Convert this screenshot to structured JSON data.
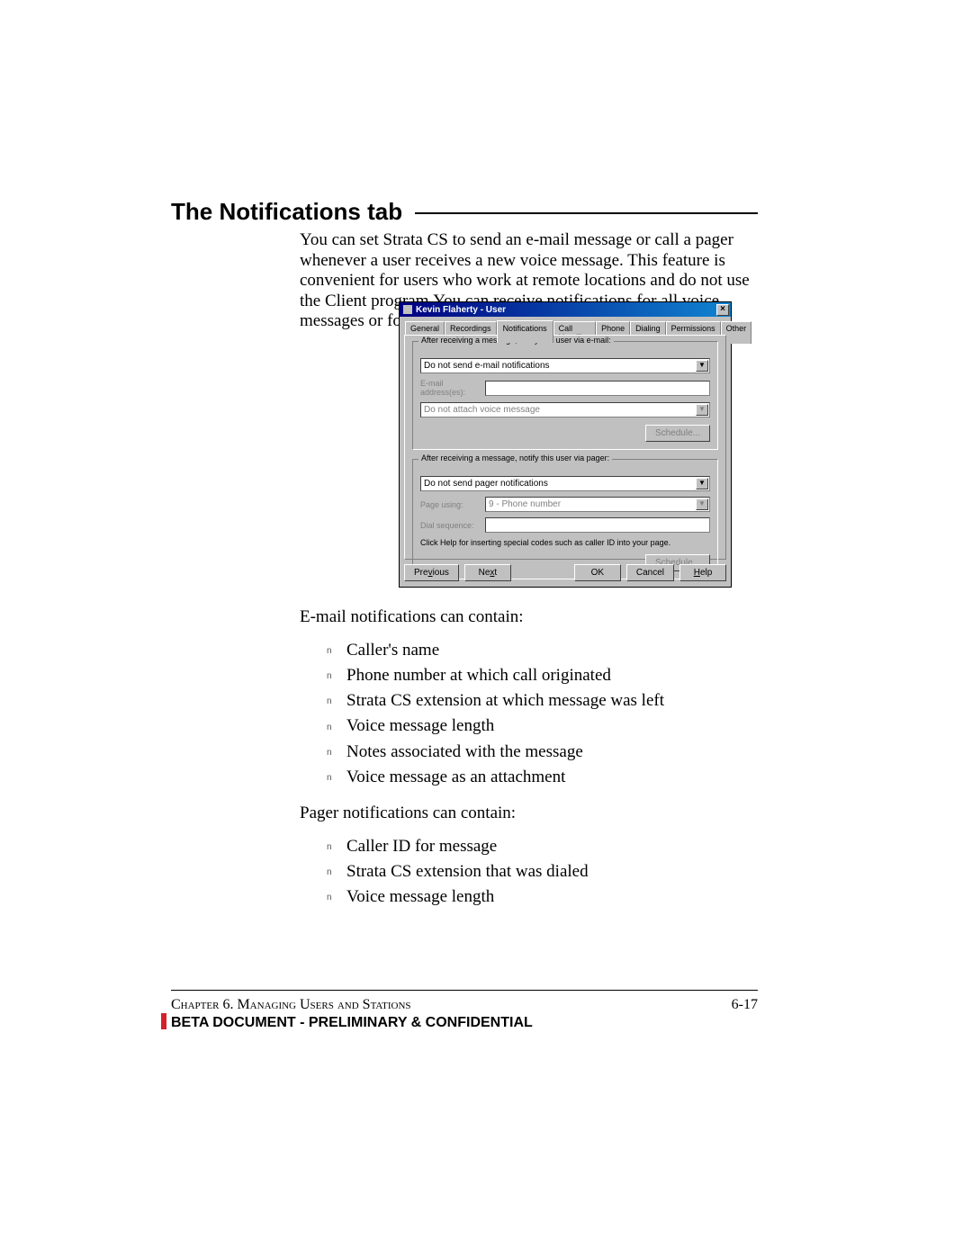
{
  "heading": "The Notifications tab",
  "intro": "You can set Strata CS to send an e-mail message or call a pager whenever a user receives a new voice message. This feature is convenient for users who work at remote locations and do not use the Client program.You can receive notifications for all voice messages or for urgent messages only.",
  "email_lead": "E-mail notifications can contain:",
  "email_bullets": [
    "Caller's name",
    "Phone number at which call originated",
    "Strata CS extension at which message was left",
    "Voice message length",
    "Notes associated with the message",
    "Voice message as an attachment"
  ],
  "pager_lead": "Pager notifications can contain:",
  "pager_bullets": [
    "Caller ID for message",
    "Strata CS extension that was dialed",
    "Voice message length"
  ],
  "footer": {
    "chapter_sc": "Chapter 6. Managing Users and Stations",
    "pagenum": "6-17",
    "conf": "BETA DOCUMENT - PRELIMINARY & CONFIDENTIAL"
  },
  "dlg": {
    "title": "Kevin Flaherty - User",
    "tabs": [
      "General",
      "Recordings",
      "Notifications",
      "Call Handling",
      "Phone",
      "Dialing",
      "Permissions",
      "Other"
    ],
    "active_tab": 2,
    "email_group": "After receiving a message, notify this user via e-mail:",
    "email_combo": "Do not send e-mail notifications",
    "email_addr_lbl": "E-mail address(es):",
    "attach_combo": "Do not attach voice message",
    "schedule_btn": "Schedule...",
    "pager_group": "After receiving a message, notify this user via pager:",
    "pager_combo": "Do not send pager notifications",
    "page_using_lbl": "Page using:",
    "page_using_val": "9 - Phone number",
    "dial_seq_lbl": "Dial sequence:",
    "help_note": "Click Help for inserting special codes such as caller ID into your page.",
    "buttons": {
      "previous": "Previous",
      "next": "Next",
      "ok": "OK",
      "cancel": "Cancel",
      "help": "Help"
    }
  }
}
